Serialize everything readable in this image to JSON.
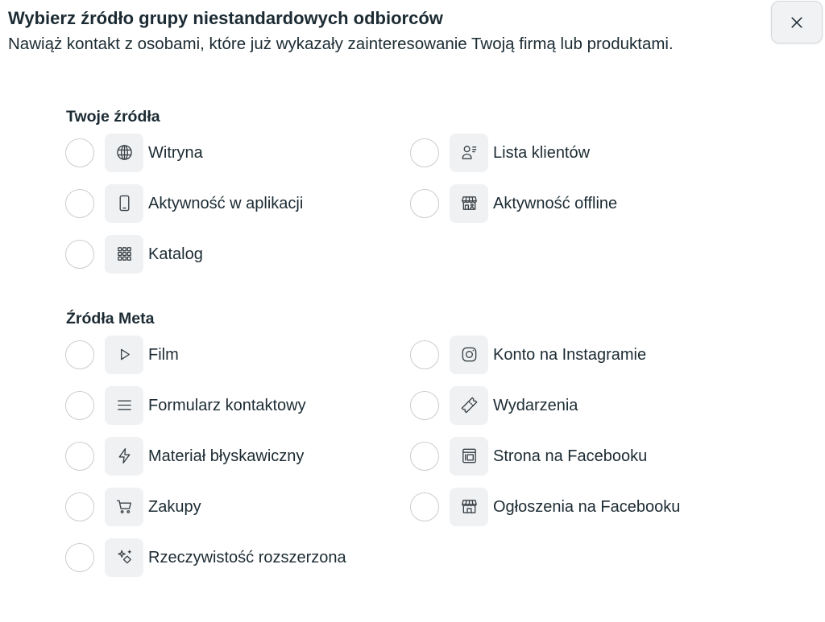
{
  "dialog": {
    "title": "Wybierz źródło grupy niestandardowych odbiorców",
    "subtitle": "Nawiąż kontakt z osobami, które już wykazały zainteresowanie Twoją firmą lub produktami.",
    "close_icon": "close-icon"
  },
  "sections": [
    {
      "heading": "Twoje źródła",
      "items": [
        {
          "label": "Witryna",
          "icon": "globe-icon",
          "selected": false
        },
        {
          "label": "Lista klientów",
          "icon": "customer-list-icon",
          "selected": false
        },
        {
          "label": "Aktywność w aplikacji",
          "icon": "mobile-phone-icon",
          "selected": false
        },
        {
          "label": "Aktywność offline",
          "icon": "store-icon",
          "selected": false
        },
        {
          "label": "Katalog",
          "icon": "catalog-grid-icon",
          "selected": false
        }
      ]
    },
    {
      "heading": "Źródła Meta",
      "items": [
        {
          "label": "Film",
          "icon": "play-icon",
          "selected": false
        },
        {
          "label": "Konto na Instagramie",
          "icon": "instagram-icon",
          "selected": false
        },
        {
          "label": "Formularz kontaktowy",
          "icon": "form-lines-icon",
          "selected": false
        },
        {
          "label": "Wydarzenia",
          "icon": "ticket-icon",
          "selected": false
        },
        {
          "label": "Materiał błyskawiczny",
          "icon": "lightning-icon",
          "selected": false
        },
        {
          "label": "Strona na Facebooku",
          "icon": "facebook-page-icon",
          "selected": false
        },
        {
          "label": "Zakupy",
          "icon": "shopping-cart-icon",
          "selected": false
        },
        {
          "label": "Ogłoszenia na Facebooku",
          "icon": "storefront-icon",
          "selected": false
        },
        {
          "label": "Rzeczywistość rozszerzona",
          "icon": "sparkles-icon",
          "selected": false
        }
      ]
    }
  ],
  "colors": {
    "text": "#1c2b33",
    "icon": "#3b4247",
    "icon_box_bg": "#eff1f3",
    "radio_border": "#c9cdd1",
    "close_button_bg": "#f1f2f4"
  }
}
